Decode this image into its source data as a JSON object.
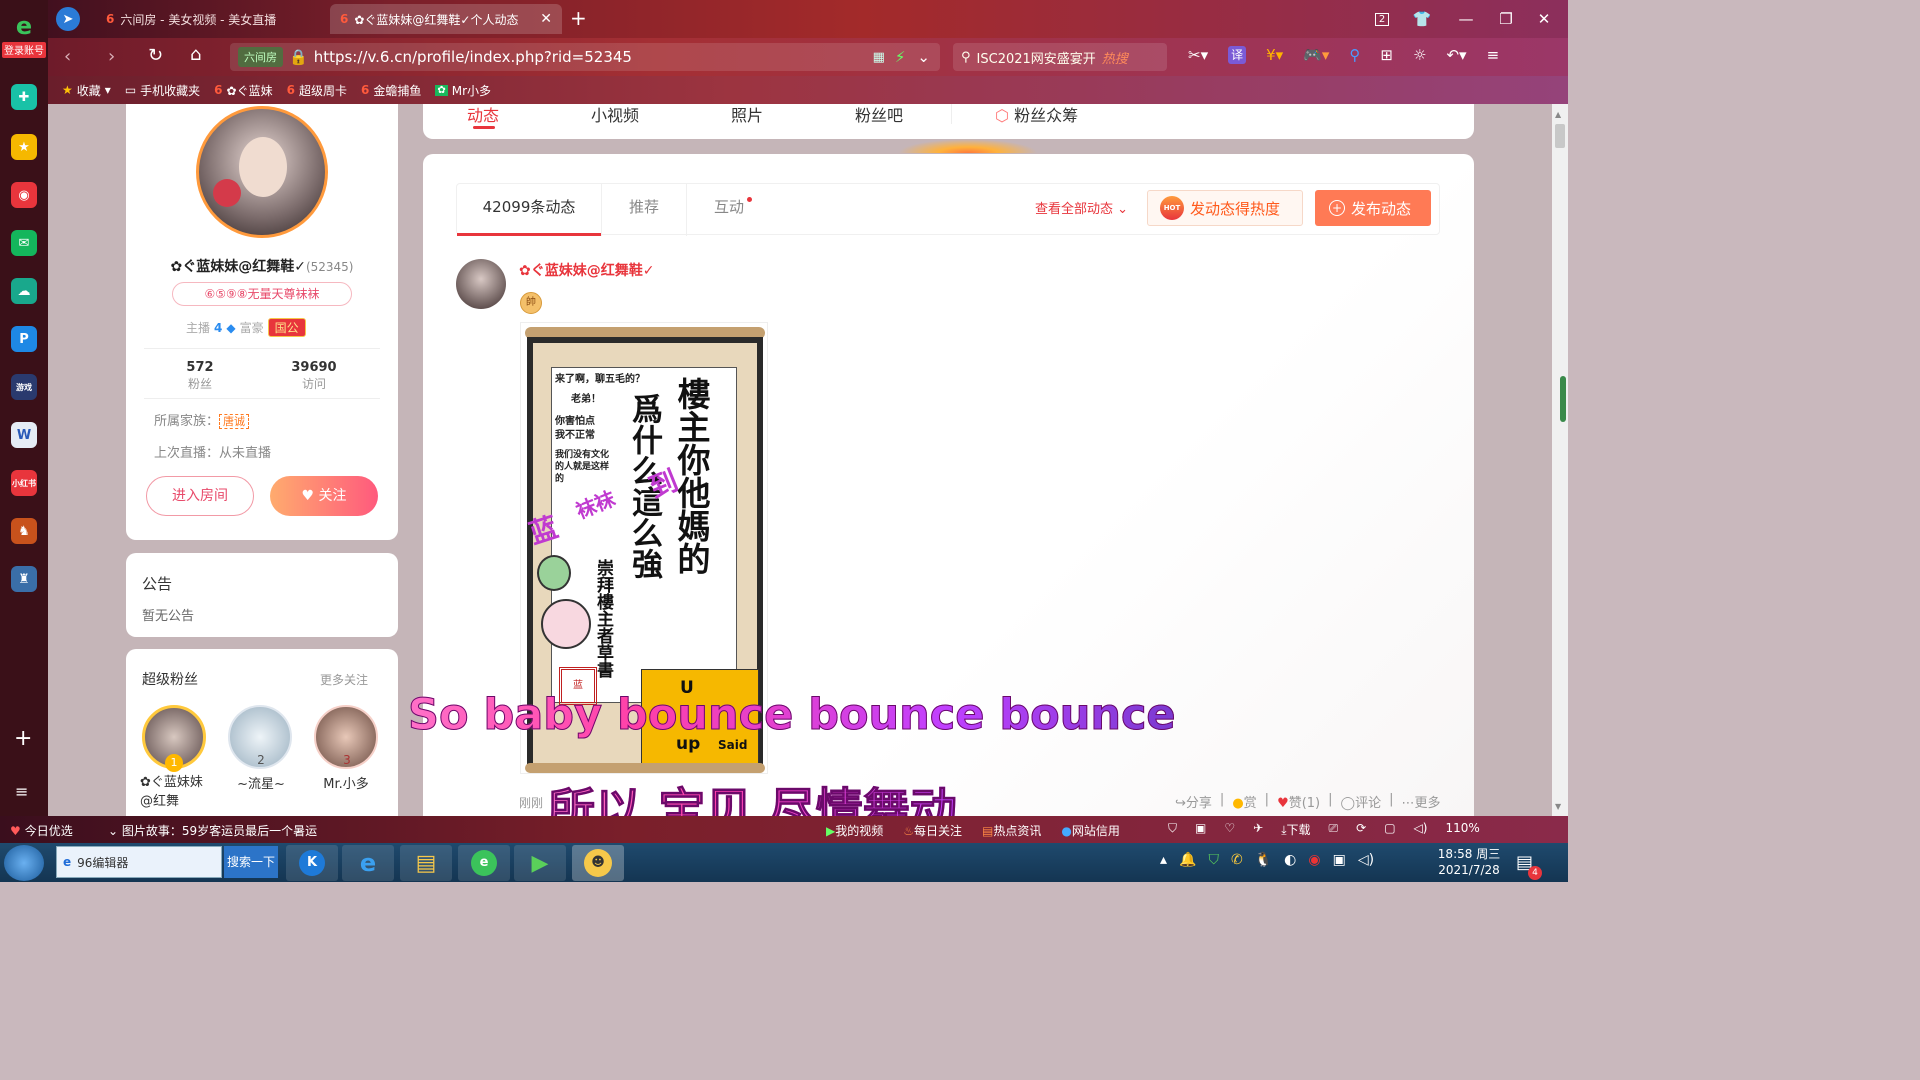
{
  "browser": {
    "tabs": [
      {
        "label": "六间房 - 美女视频 - 美女直播"
      },
      {
        "label": "✿ぐ蓝妹妹@红舞鞋✓个人动态"
      }
    ],
    "new_tab": "+",
    "tab_count": "2",
    "login_label": "登录账号",
    "url_label": "六间房",
    "url": "https://v.6.cn/profile/index.php?rid=52345",
    "search_text": "ISC2021网安盛宴开",
    "search_badge": "热搜",
    "translate": "译"
  },
  "bookmarks": [
    {
      "label": "收藏"
    },
    {
      "label": "手机收藏夹"
    },
    {
      "label": "✿ぐ蓝妹"
    },
    {
      "label": "超级周卡"
    },
    {
      "label": "金蟾捕鱼"
    },
    {
      "label": "Mr小多"
    }
  ],
  "profile": {
    "name": "✿ぐ蓝妹妹@红舞鞋✓",
    "rid": "(52345)",
    "badge": "⑥⑤⑨⑧无量天尊袜袜",
    "anchor_label": "主播",
    "anchor_level": "4",
    "rich_label": "富豪",
    "rich_badge": "国公",
    "fans_count": "572",
    "fans_label": "粉丝",
    "visits_count": "39690",
    "visits_label": "访问",
    "family_label": "所属家族：",
    "family_value": "唐诚",
    "last_live": "上次直播：从未直播",
    "enter_room": "进入房间",
    "follow": "关注"
  },
  "notice": {
    "title": "公告",
    "content": "暂无公告"
  },
  "super_fans": {
    "title": "超级粉丝",
    "more": "更多关注",
    "fans": [
      {
        "rank": "1",
        "name": "✿ぐ蓝妹妹@红舞"
      },
      {
        "rank": "2",
        "name": "~流星~"
      },
      {
        "rank": "3",
        "name": "Mr.小多"
      }
    ]
  },
  "nav_tabs": [
    "动态",
    "小视频",
    "照片",
    "粉丝吧",
    "粉丝众筹"
  ],
  "feed": {
    "tabs": [
      "42099条动态",
      "推荐",
      "互动"
    ],
    "view_all": "查看全部动态",
    "heat_button": "发动态得热度",
    "hot_badge": "HOT",
    "post_button": "发布动态",
    "post": {
      "author": "✿ぐ蓝妹妹@红舞鞋✓",
      "level_badge": "帥",
      "time": "刚刚",
      "actions": [
        "分享",
        "赏",
        "赞(1)",
        "评论",
        "更多"
      ]
    },
    "image_text": {
      "small_col1": "来了啊，聊五毛的？",
      "small_col2": "老弟！",
      "small_col3": "你害怕点",
      "small_col4": "我不正常",
      "small_col5": "我们没有文化的人就是这样的",
      "big_right": "樓主你他媽的",
      "big_mid": "爲什么這么強",
      "overlay1": "蓝",
      "overlay2": "袜袜",
      "overlay3": "到",
      "sign": "崇拜樓主者草書",
      "yellow1": "U",
      "yellow2": "up",
      "yellow3": "Said"
    }
  },
  "lyrics": {
    "line1": "So  baby  bounce  bounce  bounce",
    "line2": "所以  宝贝  尽情舞动"
  },
  "statusbar": {
    "today": "今日优选",
    "news": "图片故事：59岁客运员最后一个暑运",
    "items": [
      "我的视频",
      "每日关注",
      "热点资讯",
      "网站信用",
      "下载"
    ],
    "zoom": "110%"
  },
  "taskbar": {
    "input_text": "96编辑器",
    "search_btn": "搜索一下",
    "time": "18:58 周三",
    "date": "2021/7/28",
    "notification_count": "4"
  },
  "colors": {
    "accent_red": "#e8353c",
    "orange": "#ff7a45",
    "brand_pink": "#ff5a7d"
  }
}
